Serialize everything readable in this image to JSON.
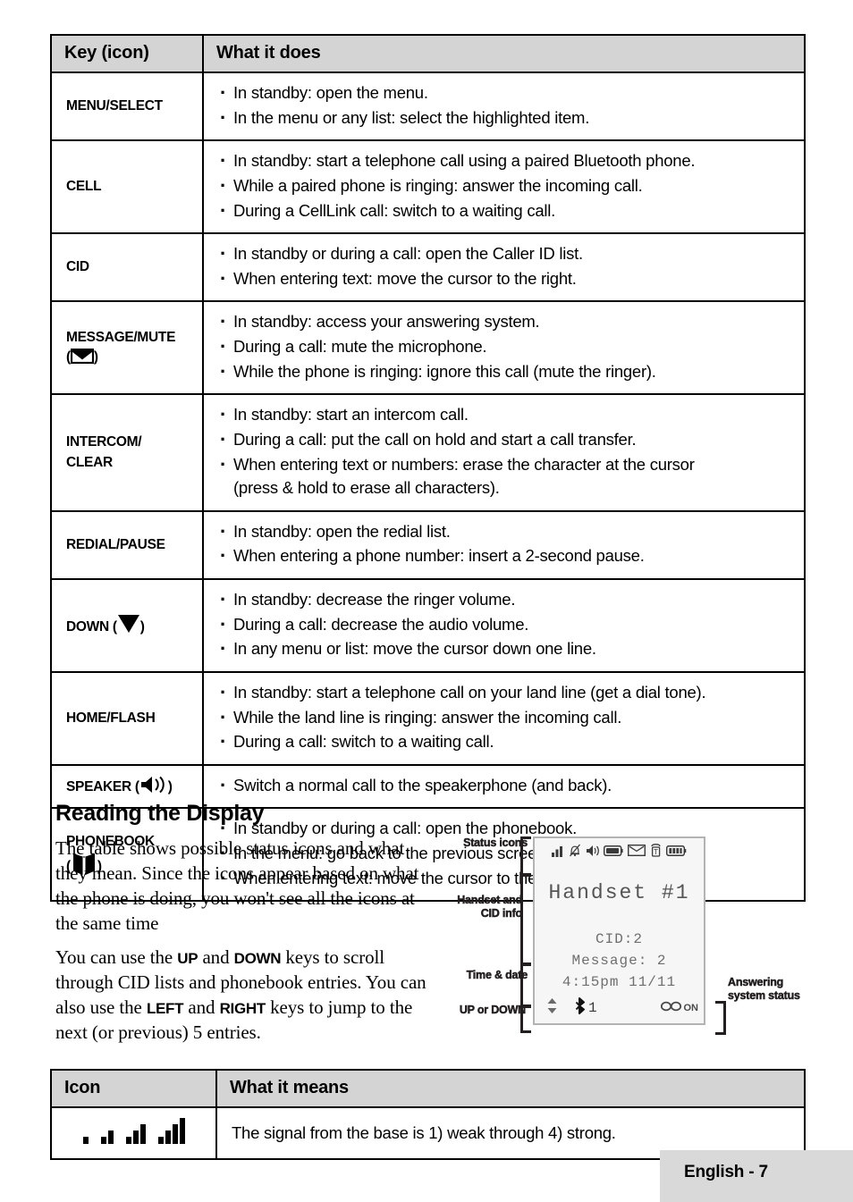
{
  "keys_table": {
    "headers": [
      "Key (icon)",
      "What it does"
    ],
    "rows": [
      {
        "key": "MENU/SELECT",
        "icon": null,
        "items": [
          "In standby: open the menu.",
          "In the menu or any list: select the highlighted item."
        ]
      },
      {
        "key": "CELL",
        "icon": null,
        "items": [
          "In standby: start a telephone call using a paired Bluetooth phone.",
          "While a paired phone is ringing: answer the incoming call.",
          "During a CellLink call: switch to a waiting call."
        ]
      },
      {
        "key": "CID",
        "icon": null,
        "items": [
          "In standby or during a call: open the Caller ID list.",
          "When entering text: move the cursor to the right."
        ]
      },
      {
        "key": "MESSAGE/MUTE",
        "icon": "envelope-icon",
        "items": [
          "In standby: access your answering system.",
          "During a call: mute the microphone.",
          "While the phone is ringing: ignore this call (mute the ringer)."
        ]
      },
      {
        "key": "INTERCOM/ CLEAR",
        "icon": null,
        "items": [
          "In standby: start an intercom call.",
          "During a call: put the call on hold and start a call transfer.",
          "When entering text or numbers: erase the character at the cursor"
        ],
        "continuation": "(press & hold to erase all characters)."
      },
      {
        "key": "REDIAL/PAUSE",
        "icon": null,
        "items": [
          "In standby: open the redial list.",
          "When entering a phone number: insert a 2-second pause."
        ]
      },
      {
        "key": "DOWN",
        "icon": "down-triangle-icon",
        "items": [
          "In standby: decrease the ringer volume.",
          "During a call: decrease the audio volume.",
          "In any menu or list: move the cursor down one line."
        ]
      },
      {
        "key": "HOME/FLASH",
        "icon": null,
        "items": [
          "In standby: start a telephone call on your land line (get a dial tone).",
          "While the land line is ringing: answer the incoming call.",
          "During a call: switch to a waiting call."
        ]
      },
      {
        "key": "SPEAKER",
        "icon": "speaker-icon",
        "items": [
          "Switch a normal call to the speakerphone (and back)."
        ]
      },
      {
        "key": "PHONEBOOK",
        "icon": "phonebook-icon",
        "items": [
          "In standby or during a call: open the phonebook.",
          "In the menu: go back to the previous screen.",
          "When entering text: move the cursor to the left."
        ]
      }
    ]
  },
  "section": {
    "title": "Reading the Display",
    "paragraph1": "The table shows possible status icons and what they mean. Since the icons appear based on what the phone is doing, you won't see all the icons at the same time",
    "paragraph2_parts": [
      "You can use the ",
      "UP",
      " and ",
      "DOWN",
      " keys to scroll through CID lists and phonebook entries. You can also use the ",
      "LEFT",
      " and ",
      "RIGHT",
      " keys to jump to the next (or previous) 5 entries."
    ]
  },
  "diagram": {
    "labels": {
      "status_icons": "Status icons",
      "handset_cid": "Handset and CID info",
      "time_date": "Time & date",
      "up_down": "UP or DOWN",
      "answering": "Answering system status"
    },
    "lcd": {
      "status_icons": [
        "signal-bars-icon",
        "ringer-off-icon",
        "speaker-icon",
        "battery-icon",
        "envelope-icon",
        "tone-icon",
        "battery-full-icon"
      ],
      "handset_line": "Handset #1",
      "cid_line": "CID:2",
      "message_line": "Message: 2",
      "time_line": "4:15pm  11/11",
      "bluetooth_count": "1",
      "answering_status": "ON"
    }
  },
  "icon_table": {
    "headers": [
      "Icon",
      "What it means"
    ],
    "rows": [
      {
        "icon": "signal-strength-icon",
        "bars": [
          1,
          2,
          3,
          4
        ],
        "meaning": "The signal from the base is 1) weak through 4) strong."
      }
    ]
  },
  "footer": {
    "label": "English - 7"
  },
  "colors": {
    "header_bg": "#d4d4d4",
    "footer_bg": "#d9d9d9",
    "lcd_bg": "#f6f6f6",
    "lcd_text": "#6f6f6f",
    "border": "#000000"
  }
}
